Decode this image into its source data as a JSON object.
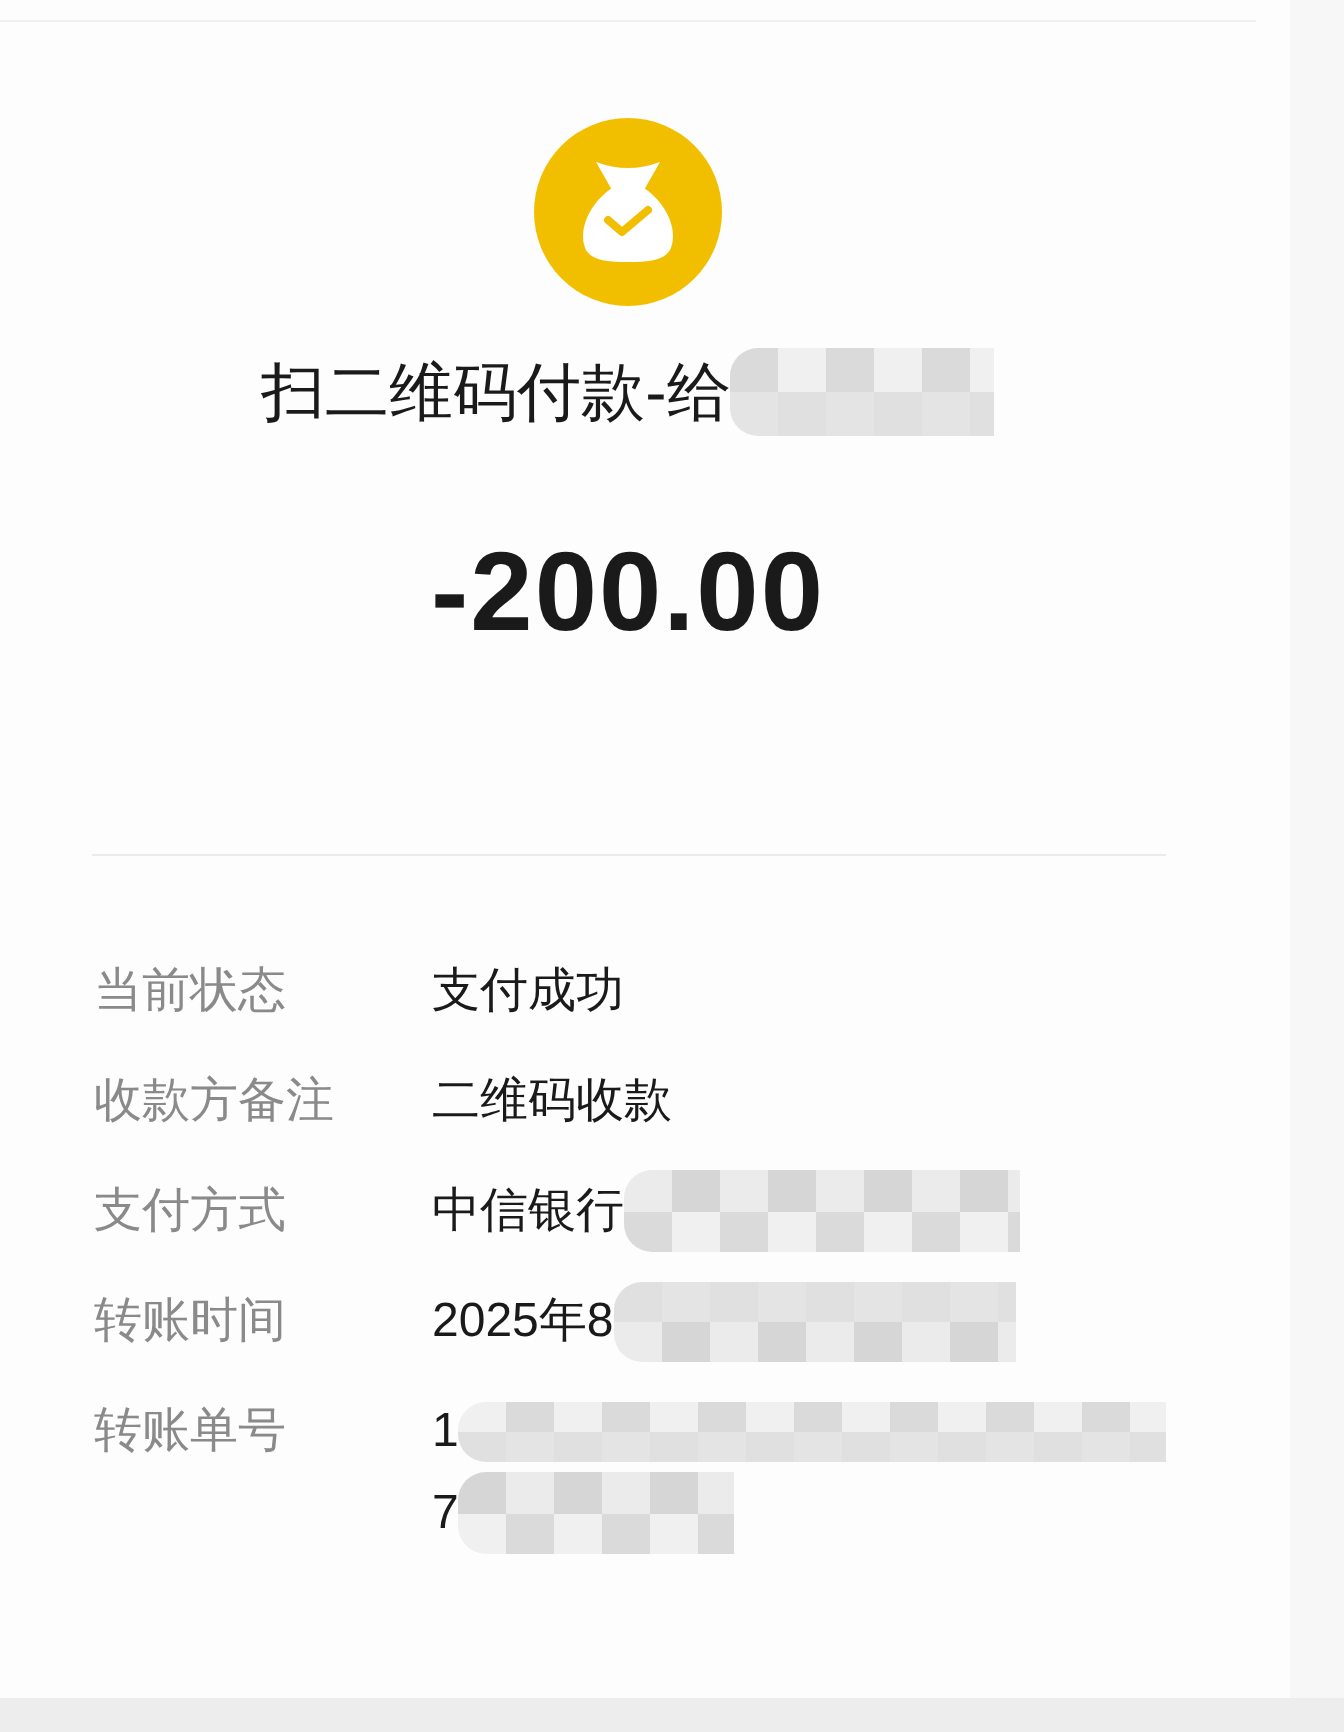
{
  "title": {
    "text": "扫二维码付款-给",
    "redacted": true
  },
  "amount": "-200.00",
  "details": [
    {
      "label": "当前状态",
      "lines": [
        {
          "text": "支付成功",
          "redacted": false
        }
      ]
    },
    {
      "label": "收款方备注",
      "lines": [
        {
          "text": "二维码收款",
          "redacted": false
        }
      ]
    },
    {
      "label": "支付方式",
      "lines": [
        {
          "text": "中信银行",
          "redacted": true
        }
      ]
    },
    {
      "label": "转账时间",
      "lines": [
        {
          "text": "2025年8",
          "redacted": true
        }
      ]
    },
    {
      "label": "转账单号",
      "lines": [
        {
          "text": "1",
          "redacted": true
        },
        {
          "text": "7",
          "redacted": true
        }
      ]
    }
  ]
}
